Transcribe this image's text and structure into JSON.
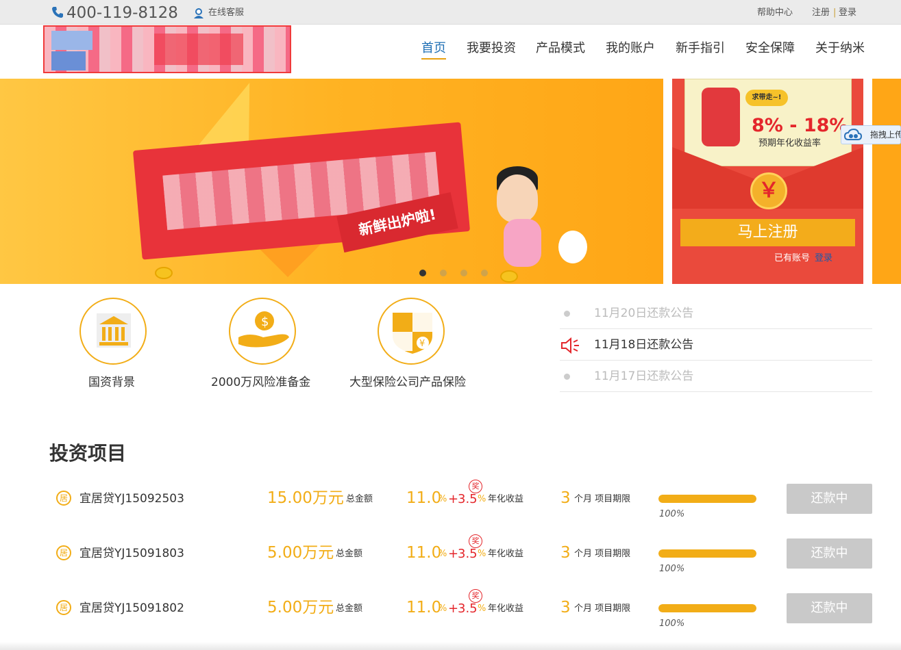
{
  "topbar": {
    "phone": "400-119-8128",
    "customer_service": "在线客服",
    "help": "帮助中心",
    "register": "注册",
    "separator": "|",
    "login": "登录"
  },
  "nav": {
    "items": [
      "首页",
      "我要投资",
      "产品模式",
      "我的账户",
      "新手指引",
      "安全保障",
      "关于纳米"
    ],
    "active": "首页"
  },
  "banner": {
    "tag": "新鲜出炉啦!",
    "slide_count": 4,
    "active_slide": 1
  },
  "register_card": {
    "bubble": "求带走~!",
    "rate": "8% - 18%",
    "rate_label": "预期年化收益率",
    "yuan_symbol": "￥",
    "button": "马上注册",
    "have_account": "已有账号",
    "login": "登录"
  },
  "floating_upload": {
    "label": "拖拽上传"
  },
  "features": [
    {
      "label": "国资背景",
      "icon": "bank-icon"
    },
    {
      "label": "2000万风险准备金",
      "icon": "money-hand-icon"
    },
    {
      "label": "大型保险公司产品保险",
      "icon": "insurance-shield-icon"
    }
  ],
  "announcements": [
    {
      "text": "11月20日还款公告",
      "active": false
    },
    {
      "text": "11月18日还款公告",
      "active": true
    },
    {
      "text": "11月17日还款公告",
      "active": false
    }
  ],
  "projects": {
    "title": "投资项目",
    "rows": [
      {
        "icon": "居",
        "name": "宜居贷YJ15092503",
        "amount": "15.00万元",
        "amount_label": "总金额",
        "rate": "11.0",
        "rate_pct": "%",
        "plus": "+",
        "bonus": "3.5",
        "bonus_pct": "%",
        "bonus_badge": "奖",
        "rate_label": "年化收益",
        "term": "3",
        "term_label": "个月 项目期限",
        "progress": 100,
        "progress_text": "100%",
        "status": "还款中"
      },
      {
        "icon": "居",
        "name": "宜居贷YJ15091803",
        "amount": "5.00万元",
        "amount_label": "总金额",
        "rate": "11.0",
        "rate_pct": "%",
        "plus": "+",
        "bonus": "3.5",
        "bonus_pct": "%",
        "bonus_badge": "奖",
        "rate_label": "年化收益",
        "term": "3",
        "term_label": "个月 项目期限",
        "progress": 100,
        "progress_text": "100%",
        "status": "还款中"
      },
      {
        "icon": "居",
        "name": "宜居贷YJ15091802",
        "amount": "5.00万元",
        "amount_label": "总金额",
        "rate": "11.0",
        "rate_pct": "%",
        "plus": "+",
        "bonus": "3.5",
        "bonus_pct": "%",
        "bonus_badge": "奖",
        "rate_label": "年化收益",
        "term": "3",
        "term_label": "个月 项目期限",
        "progress": 100,
        "progress_text": "100%",
        "status": "还款中"
      }
    ]
  },
  "colors": {
    "accent": "#f2ad17",
    "link": "#1f6fb4",
    "red": "#e4262b",
    "status_button": "#c9c9c9"
  }
}
